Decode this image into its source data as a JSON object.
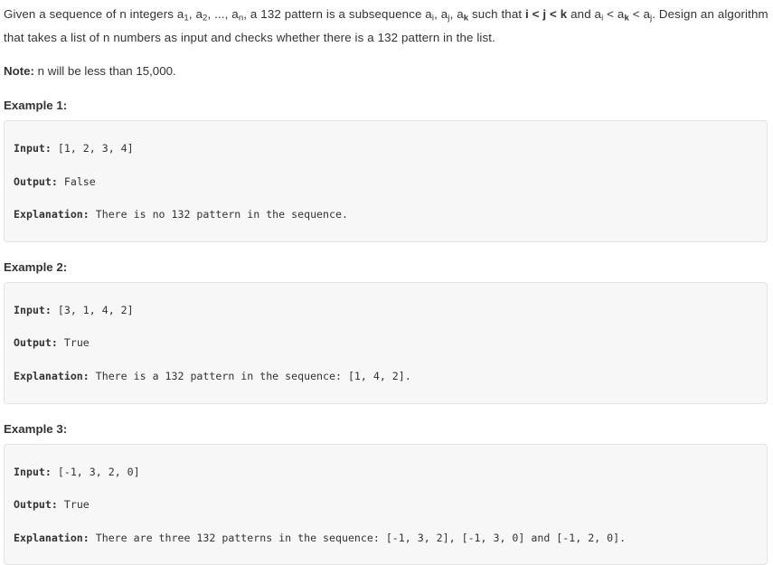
{
  "statement": {
    "part1": "Given a sequence of n integers a",
    "sub1": "1",
    "part2": ", a",
    "sub2": "2",
    "part3": ", ..., a",
    "sub3": "n",
    "part4": ", a 132 pattern is a subsequence a",
    "sub4": "i",
    "part5": ", a",
    "sub5": "j",
    "part6": ", a",
    "sub6": "k",
    "part7": " such that ",
    "bold_condition": "i < j < k",
    "part8": " and a",
    "sub7": "i",
    "part9": " < a",
    "sub8": "k",
    "part10": " < a",
    "sub9": "j",
    "part11": ". Design an algorithm that takes a list of n numbers as input and checks whether there is a 132 pattern in the list."
  },
  "note": {
    "label": "Note:",
    "text": " n will be less than 15,000."
  },
  "examples": [
    {
      "heading": "Example 1:",
      "lines": [
        {
          "label": "Input:",
          "value": " [1, 2, 3, 4]"
        },
        {
          "label": "Output:",
          "value": " False"
        },
        {
          "label": "Explanation:",
          "value": " There is no 132 pattern in the sequence."
        }
      ]
    },
    {
      "heading": "Example 2:",
      "lines": [
        {
          "label": "Input:",
          "value": " [3, 1, 4, 2]"
        },
        {
          "label": "Output:",
          "value": " True"
        },
        {
          "label": "Explanation:",
          "value": " There is a 132 pattern in the sequence: [1, 4, 2]."
        }
      ]
    },
    {
      "heading": "Example 3:",
      "lines": [
        {
          "label": "Input:",
          "value": " [-1, 3, 2, 0]"
        },
        {
          "label": "Output:",
          "value": " True"
        },
        {
          "label": "Explanation:",
          "value": " There are three 132 patterns in the sequence: [-1, 3, 2], [-1, 3, 0] and [-1, 2, 0]."
        }
      ]
    }
  ],
  "colors": {
    "text": "#333333",
    "code_background": "#f7f7f7",
    "code_border": "#e3e3e3",
    "page_background": "#ffffff"
  }
}
